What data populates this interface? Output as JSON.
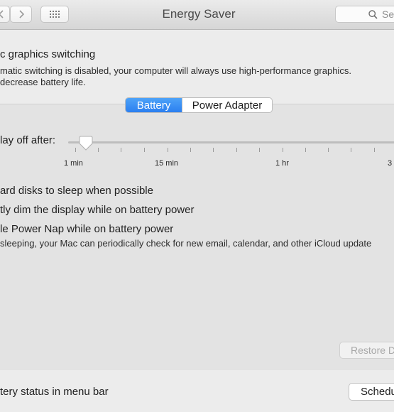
{
  "window": {
    "title": "Energy Saver"
  },
  "search": {
    "text": "Se"
  },
  "graphics": {
    "title": "c graphics switching",
    "desc_line1": "matic switching is disabled, your computer will always use high-performance graphics.",
    "desc_line2": "decrease battery life."
  },
  "tabs": {
    "battery": "Battery",
    "power_adapter": "Power Adapter"
  },
  "display_sleep": {
    "label": "lay off after:",
    "level": 0.05,
    "ticks": {
      "t1": "1 min",
      "t2": "15 min",
      "t3": "1 hr",
      "t4": "3"
    }
  },
  "options": {
    "hard_disks": "ard disks to sleep when possible",
    "dim_display": "tly dim the display while on battery power",
    "power_nap": "le Power Nap while on battery power",
    "power_nap_desc": "sleeping, your Mac can periodically check for new email, calendar, and other iCloud update"
  },
  "buttons": {
    "restore": "Restore D",
    "schedule": "Schedu"
  },
  "footer": {
    "battery_status": "tery status in menu bar"
  },
  "colors": {
    "accent": "#2b7ff0"
  }
}
